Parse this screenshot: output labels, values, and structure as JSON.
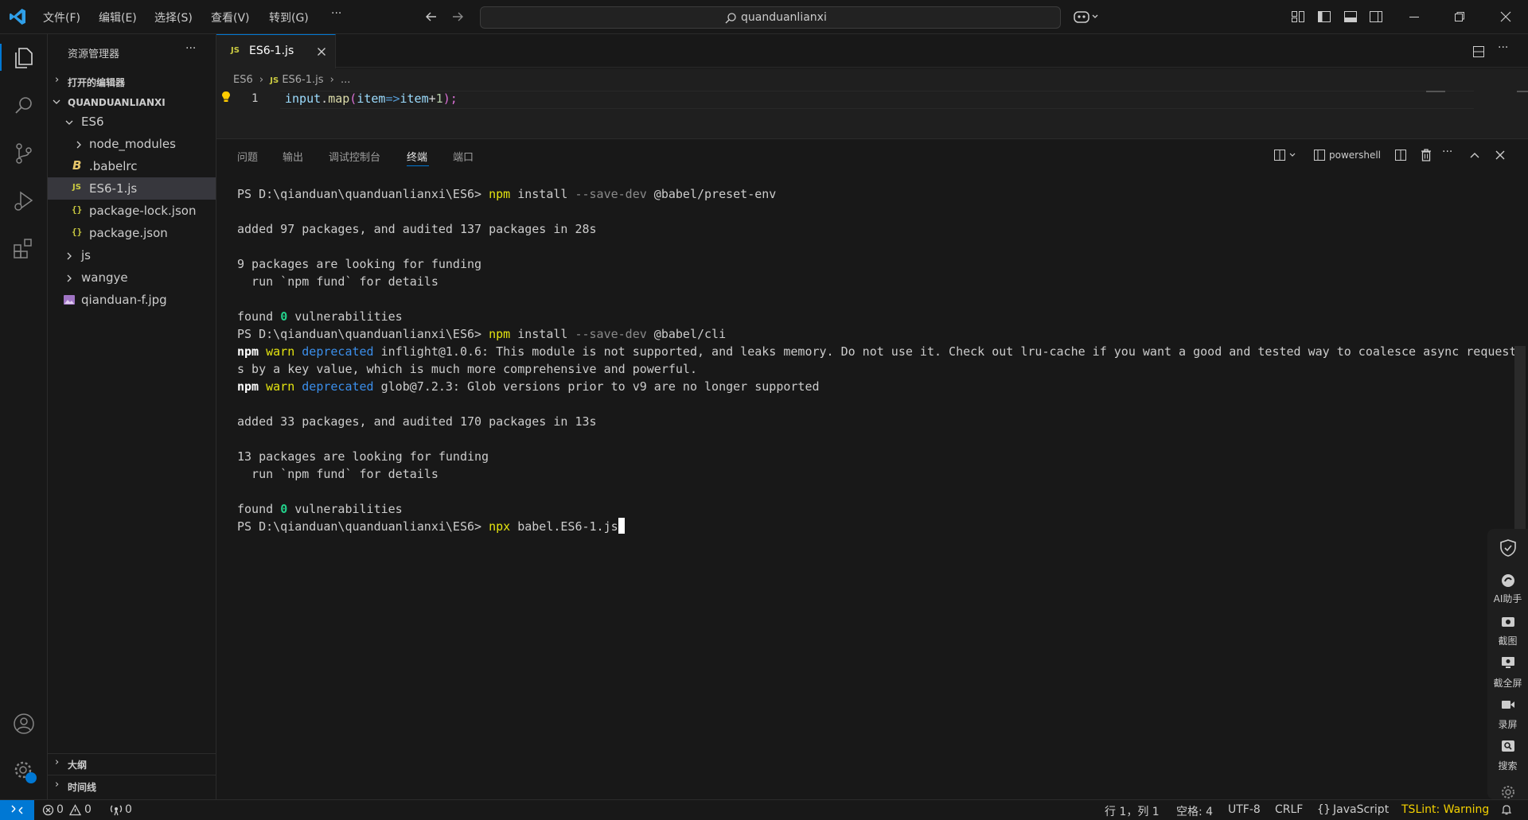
{
  "titlebar": {
    "menus": [
      "文件(F)",
      "编辑(E)",
      "选择(S)",
      "查看(V)",
      "转到(G)"
    ],
    "more": "···",
    "search": "quanduanlianxi"
  },
  "sidebar": {
    "title": "资源管理器",
    "more": "···",
    "open_editors": "打开的编辑器",
    "workspace": "QUANDUANLIANXI",
    "items": [
      {
        "label": "ES6",
        "icon": "chevron-down-icon"
      },
      {
        "label": "node_modules",
        "icon": "chevron-right-icon"
      },
      {
        "label": ".babelrc",
        "icon": "babel-file-icon"
      },
      {
        "label": "ES6-1.js",
        "icon": "js-file-icon"
      },
      {
        "label": "package-lock.json",
        "icon": "json-file-icon"
      },
      {
        "label": "package.json",
        "icon": "json-file-icon"
      },
      {
        "label": "js",
        "icon": "chevron-right-icon"
      },
      {
        "label": "wangye",
        "icon": "chevron-right-icon"
      },
      {
        "label": "qianduan-f.jpg",
        "icon": "image-file-icon"
      }
    ],
    "outline": "大纲",
    "timeline": "时间线"
  },
  "editor": {
    "tab_label": "ES6-1.js",
    "tab_badge": "JS",
    "breadcrumb": [
      "ES6",
      "ES6-1.js",
      "..."
    ],
    "line_number": "1",
    "code": {
      "a": "input",
      "b": ".",
      "c": "map",
      "d": "(",
      "e": "item",
      "f": "=>",
      "g": "item",
      "h": "+",
      "i": "1",
      "j": ");"
    }
  },
  "panel": {
    "tabs": [
      "问题",
      "输出",
      "调试控制台",
      "终端",
      "端口"
    ],
    "active_tab": "终端",
    "shell": "powershell",
    "terminal": {
      "prompt": "PS D:\\qianduan\\quanduanlianxi\\ES6> ",
      "cmd1": {
        "a": "npm",
        "b": " install ",
        "c": "--save-dev",
        "d": " @babel/preset-env"
      },
      "l_added1": "added 97 packages, and audited 137 packages in 28s",
      "l_funding1": "9 packages are looking for funding",
      "l_fund": "  run `npm fund` for details",
      "l_found": "found ",
      "zero": "0",
      "l_vuln": " vulnerabilities",
      "cmd2": {
        "a": "npm",
        "b": " install ",
        "c": "--save-dev",
        "d": " @babel/cli"
      },
      "warn1": {
        "npm": "npm",
        "warn": " warn",
        "dep": " deprecated",
        "msg": " inflight@1.0.6: This module is not supported, and leaks memory. Do not use it. Check out lru-cache if you want a good and tested way to coalesce async request",
        "cont": "s by a key value, which is much more comprehensive and powerful."
      },
      "warn2": {
        "npm": "npm",
        "warn": " warn",
        "dep": " deprecated",
        "msg": " glob@7.2.3: Glob versions prior to v9 are no longer supported"
      },
      "l_added2": "added 33 packages, and audited 170 packages in 13s",
      "l_funding2": "13 packages are looking for funding",
      "cmd3": {
        "a": "npx",
        "b": " babel.ES6-1.js"
      }
    }
  },
  "statusbar": {
    "errors": "0",
    "warnings": "0",
    "ports": "0",
    "position": "行 1，列 1",
    "spaces": "空格: 4",
    "encoding": "UTF-8",
    "eol": "CRLF",
    "language": "JavaScript",
    "lang_icon": "{}",
    "tslint": "TSLint: Warning"
  },
  "floattool": {
    "items": [
      "AI助手",
      "截图",
      "截全屏",
      "录屏",
      "搜索"
    ]
  },
  "colors": {
    "accent": "#0078d4",
    "js_yellow": "#cbcb41",
    "warning": "#cca700"
  }
}
